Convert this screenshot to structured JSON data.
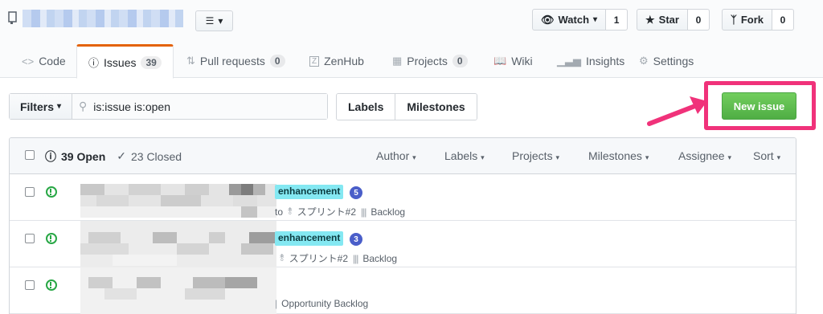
{
  "header": {
    "watch": {
      "label": "Watch",
      "count": "1"
    },
    "star": {
      "label": "Star",
      "count": "0"
    },
    "fork": {
      "label": "Fork",
      "count": "0"
    }
  },
  "tabs": [
    {
      "label": "Code"
    },
    {
      "label": "Issues",
      "count": "39"
    },
    {
      "label": "Pull requests",
      "count": "0"
    },
    {
      "label": "ZenHub"
    },
    {
      "label": "Projects",
      "count": "0"
    },
    {
      "label": "Wiki"
    },
    {
      "label": "Insights"
    },
    {
      "label": "Settings"
    }
  ],
  "filters": {
    "button": "Filters",
    "query": "is:issue is:open",
    "labels": "Labels",
    "milestones": "Milestones",
    "new_issue": "New issue"
  },
  "list_header": {
    "open": "39 Open",
    "closed": "23 Closed",
    "menus": [
      "Author",
      "Labels",
      "Projects",
      "Milestones",
      "Assignee",
      "Sort"
    ]
  },
  "issues": [
    {
      "label": "enhancement",
      "comments": "5",
      "meta_prefix": "to",
      "milestone": "スプリント#2",
      "project": "Backlog"
    },
    {
      "label": "enhancement",
      "comments": "3",
      "milestone": "スプリント#2",
      "project": "Backlog"
    },
    {
      "project": "Opportunity Backlog"
    }
  ],
  "colors": {
    "accent_tab": "#e36209",
    "new_issue": "#4fae44",
    "highlight": "#f0327a",
    "label_enhancement": "#84e8f2",
    "open_icon": "#28a745"
  }
}
